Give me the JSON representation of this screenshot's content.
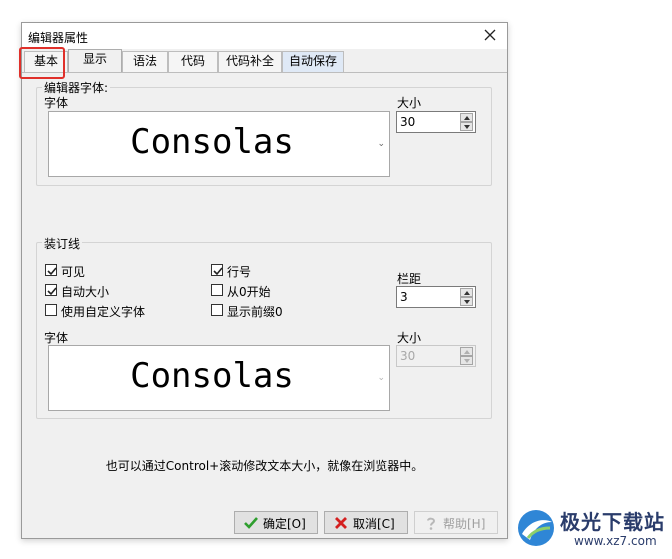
{
  "dialog": {
    "title": "编辑器属性"
  },
  "tabs": [
    "基本",
    "显示",
    "语法",
    "代码",
    "代码补全",
    "自动保存"
  ],
  "editor_font": {
    "group_label": "编辑器字体:",
    "font_label": "字体",
    "font_value": "Consolas",
    "size_label": "大小",
    "size_value": "30"
  },
  "gutter": {
    "group_label": "装订线",
    "visible_label": "可见",
    "line_numbers_label": "行号",
    "auto_size_label": "自动大小",
    "start_zero_label": "从0开始",
    "custom_font_label": "使用自定义字体",
    "leading_zeros_label": "显示前缀0",
    "margin_label": "栏距",
    "margin_value": "3",
    "font_label": "字体",
    "font_value": "Consolas",
    "size_label": "大小",
    "size_value": "30"
  },
  "hint": "也可以通过Control+滚动修改文本大小，就像在浏览器中。",
  "buttons": {
    "ok": "确定[O]",
    "cancel": "取消[C]",
    "help": "帮助[H]"
  },
  "watermark": {
    "name": "极光下载站",
    "url": "www.xz7.com"
  },
  "colors": {
    "highlight_border": "#e0302a",
    "ok_check": "#2e9e2e",
    "cancel_x": "#d42020",
    "watermark_text": "#2a3c6b"
  }
}
